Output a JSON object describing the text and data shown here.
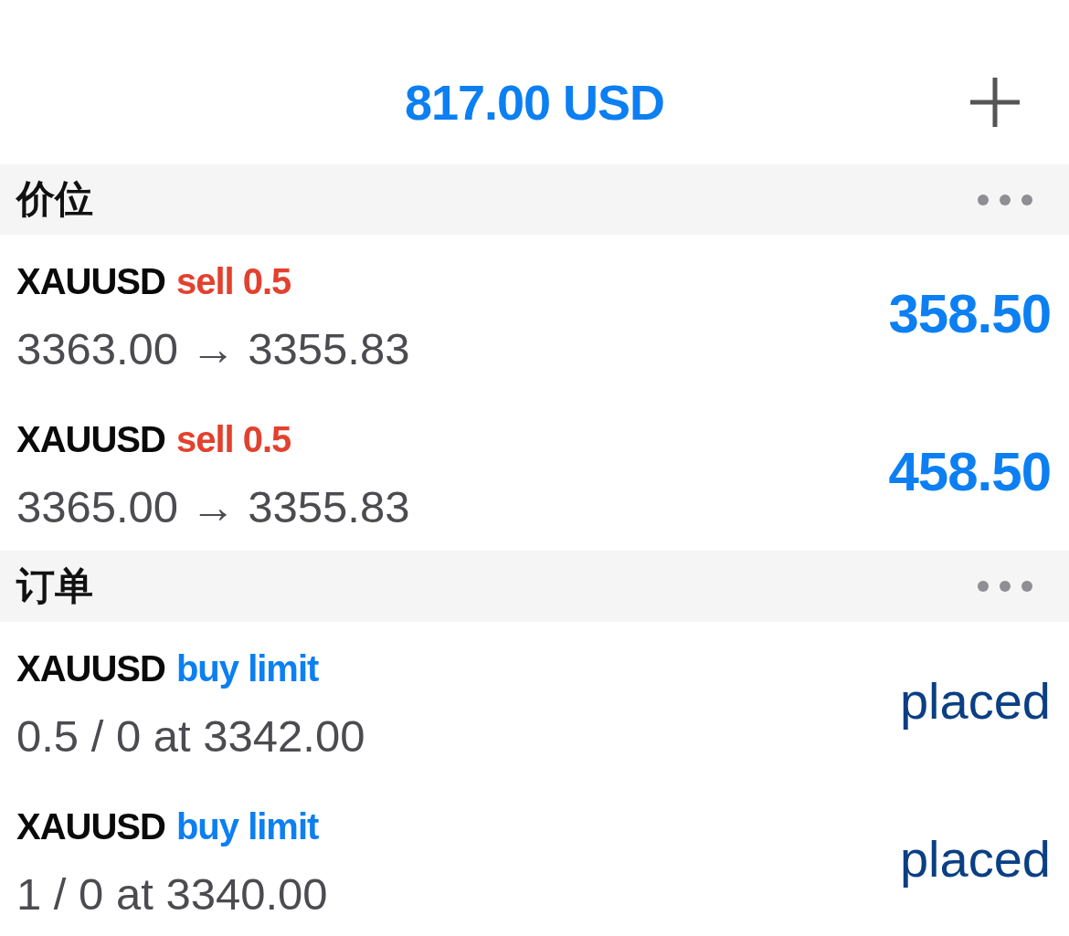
{
  "header": {
    "balance": "817.00 USD"
  },
  "sections": [
    {
      "title": "价位",
      "items": [
        {
          "kind": "position",
          "color": "#e2412e",
          "symbol": "XAUUSD",
          "action": "sell 0.5",
          "detail": "3363.00 → 3355.83",
          "result": "358.50"
        },
        {
          "kind": "position",
          "color": "#e2412e",
          "symbol": "XAUUSD",
          "action": "sell 0.5",
          "detail": "3365.00 → 3355.83",
          "result": "458.50"
        }
      ]
    },
    {
      "title": "订单",
      "items": [
        {
          "kind": "order",
          "color": "#0c7ff2",
          "symbol": "XAUUSD",
          "action": "buy limit",
          "detail": "0.5 / 0 at 3342.00",
          "result": "placed"
        },
        {
          "kind": "order",
          "color": "#0c7ff2",
          "symbol": "XAUUSD",
          "action": "buy limit",
          "detail": "1 / 0 at 3340.00",
          "result": "placed"
        }
      ]
    }
  ]
}
